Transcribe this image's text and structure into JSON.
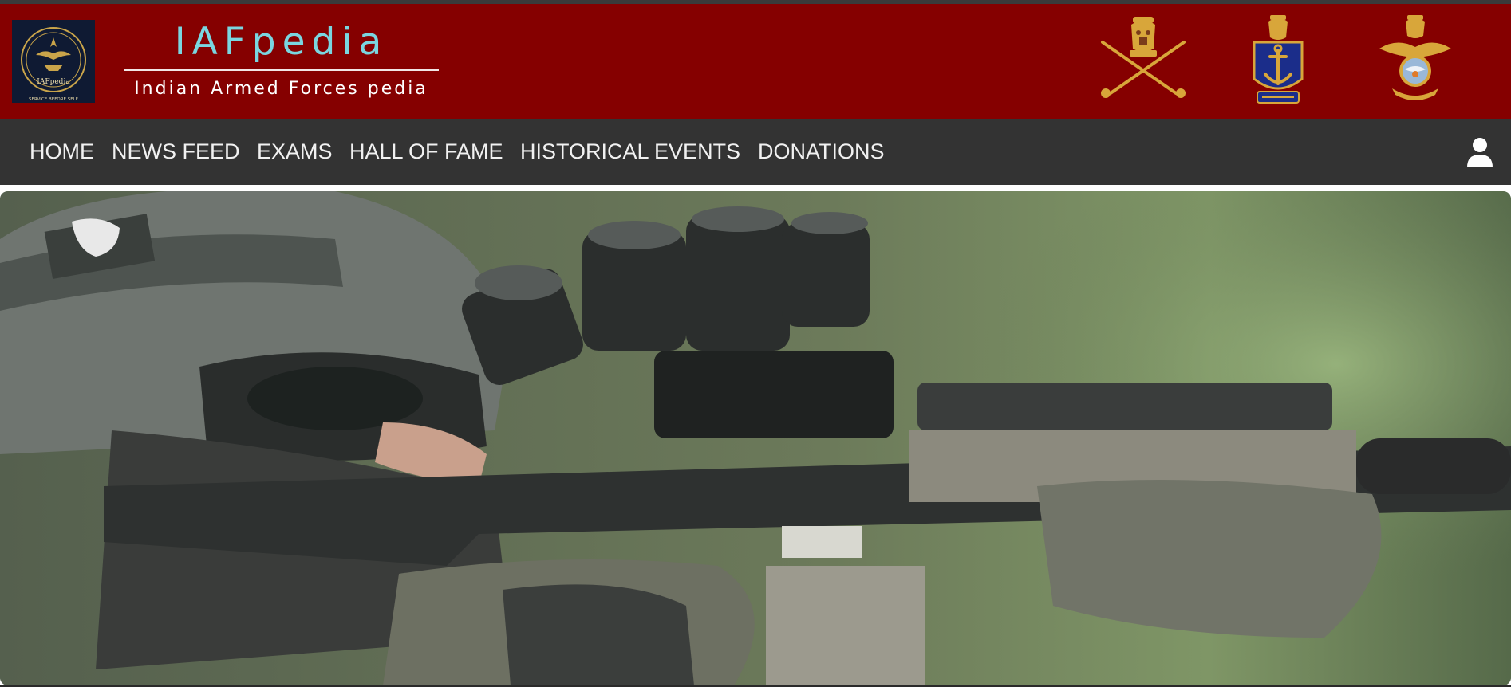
{
  "header": {
    "logo_text": "IAFpedia",
    "logo_motto": "SERVICE BEFORE SELF",
    "title": "IAFpedia",
    "subtitle": "Indian Armed Forces pedia",
    "emblems": [
      "army-emblem",
      "navy-emblem",
      "air-force-emblem"
    ]
  },
  "nav": {
    "items": [
      {
        "label": "HOME"
      },
      {
        "label": "NEWS FEED"
      },
      {
        "label": "EXAMS"
      },
      {
        "label": "HALL OF FAME"
      },
      {
        "label": "HISTORICAL EVENTS"
      },
      {
        "label": "DONATIONS"
      }
    ],
    "user_icon": "user-icon"
  },
  "hero": {
    "image": "soldier-with-night-vision-and-rifle"
  },
  "colors": {
    "header_bg": "#850000",
    "nav_bg": "#333333",
    "title_color": "#7ad6e0",
    "nav_text": "#f1f1f1"
  }
}
